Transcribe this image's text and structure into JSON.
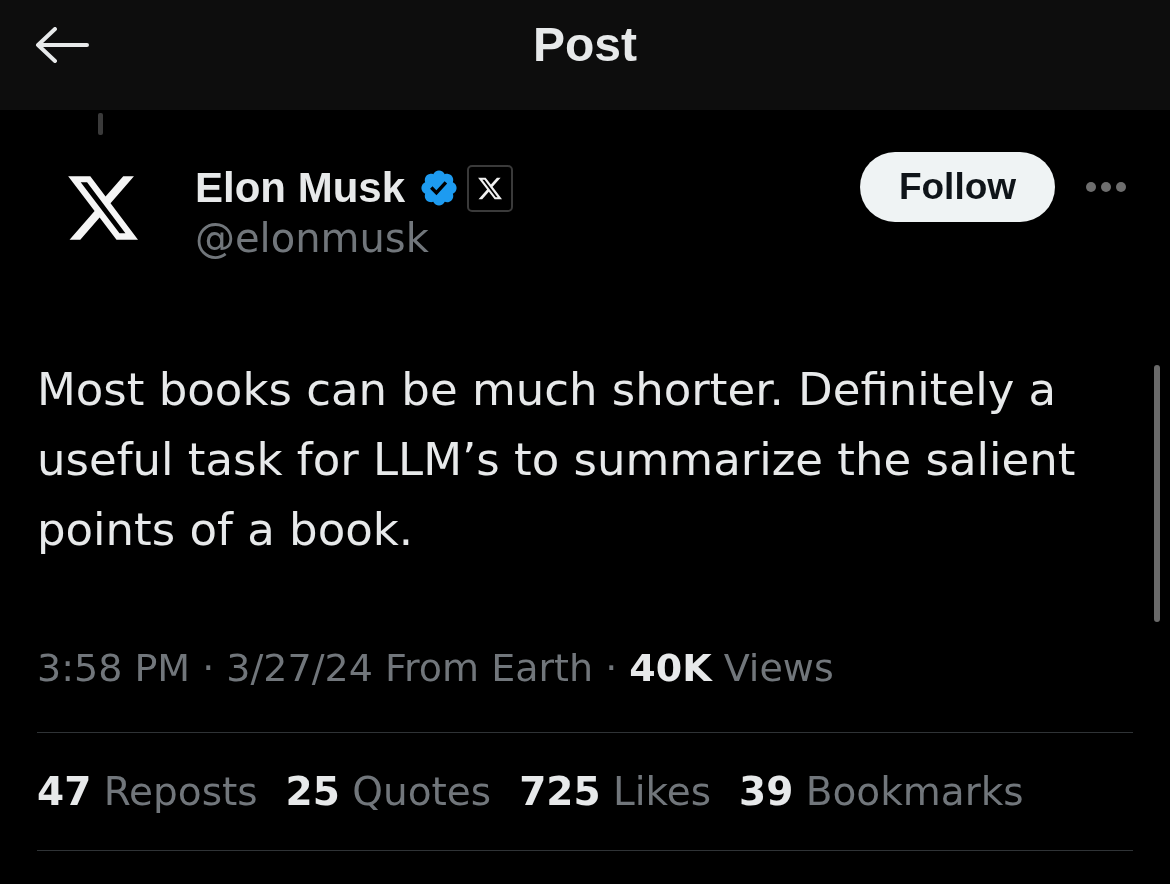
{
  "header": {
    "title": "Post"
  },
  "post": {
    "author": {
      "name": "Elon Musk",
      "handle": "@elonmusk",
      "verified": true,
      "affiliate_badge": true
    },
    "follow_button": {
      "label": "Follow"
    },
    "text": "Most books can be much shorter. Definitely a useful task for LLM’s to summarize the salient points of a book.",
    "meta": "3:58 PM · 3/27/24 From Earth · **40K** Views",
    "stats": [
      {
        "count": "47",
        "label": "Reposts"
      },
      {
        "count": "25",
        "label": "Quotes"
      },
      {
        "count": "725",
        "label": "Likes"
      },
      {
        "count": "39",
        "label": "Bookmarks"
      }
    ]
  }
}
